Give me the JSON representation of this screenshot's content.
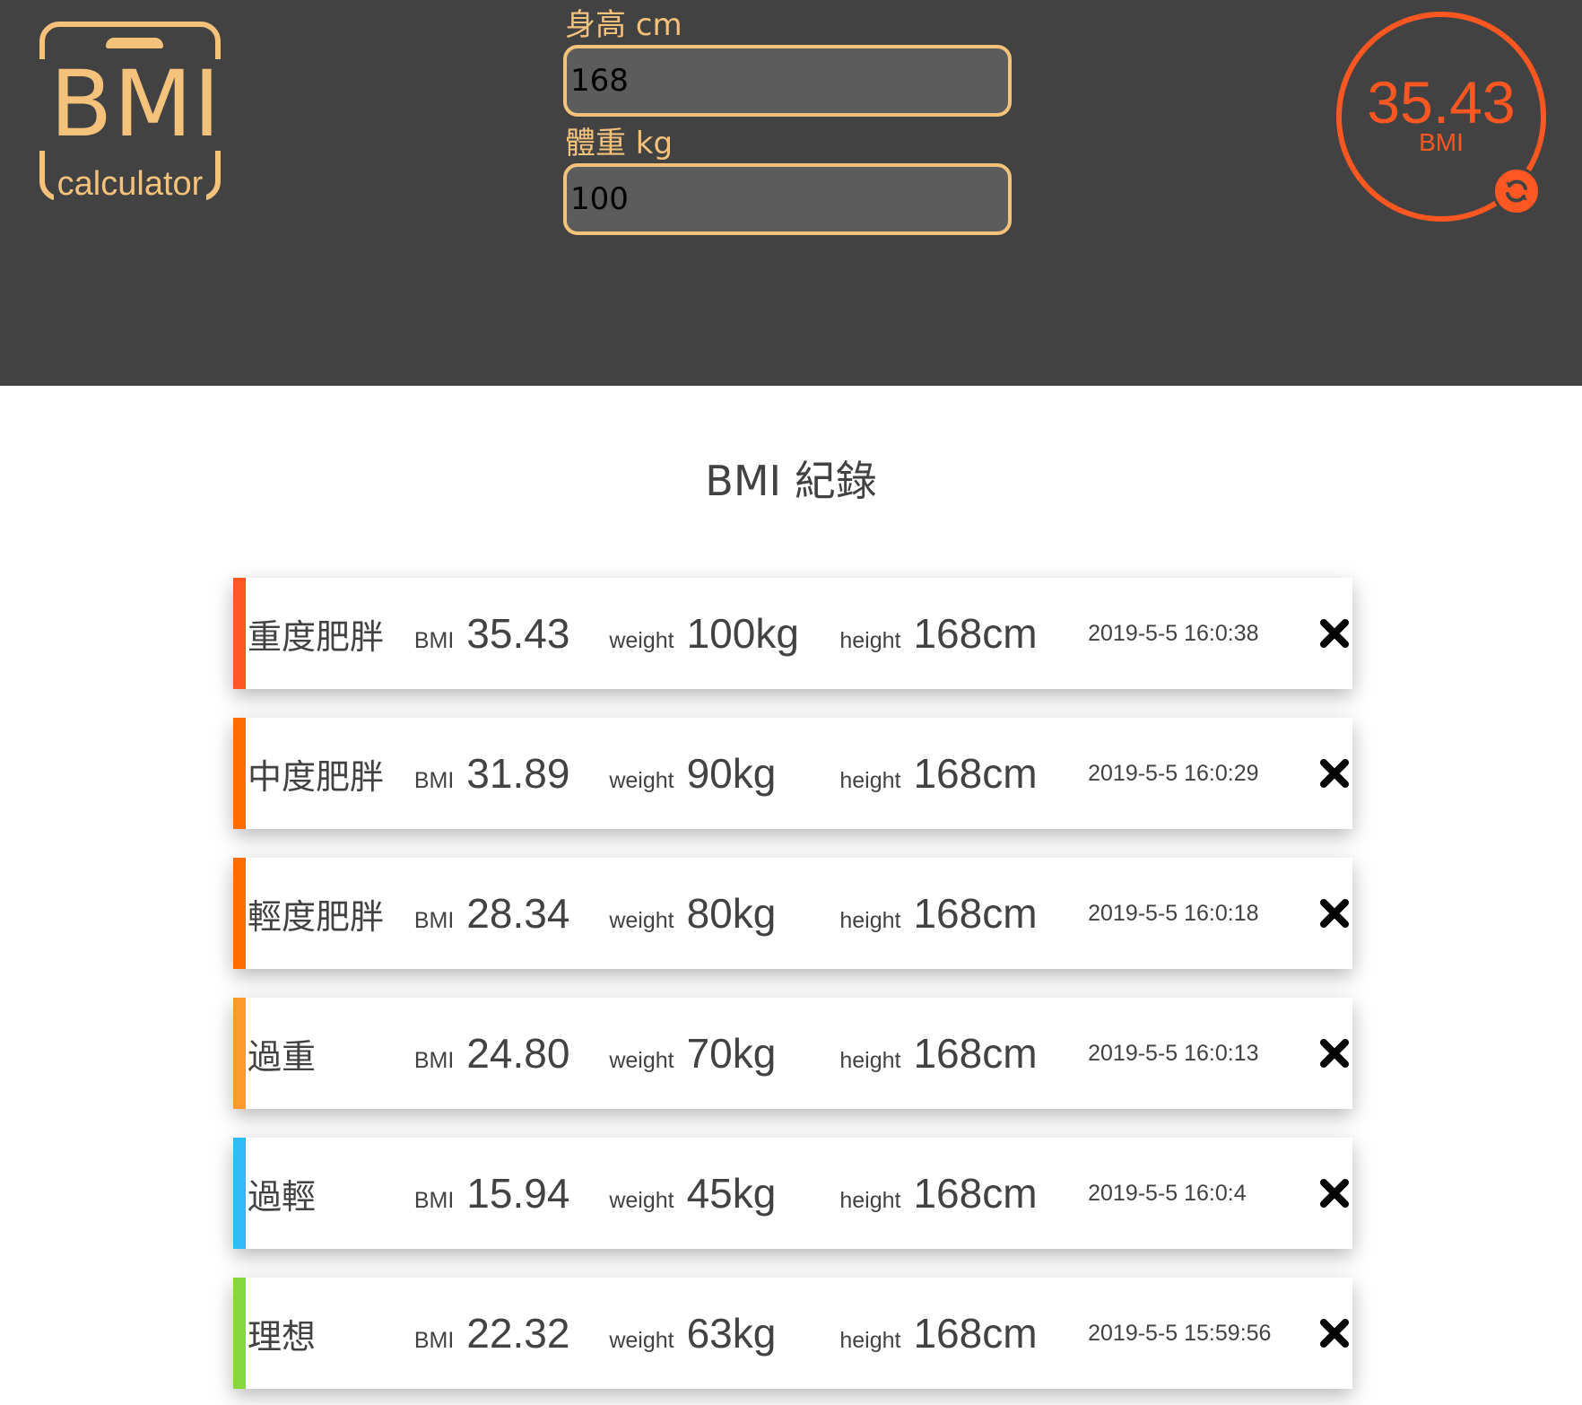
{
  "logo": {
    "text": "BMI",
    "subtitle": "calculator"
  },
  "form": {
    "height_label": "身高 cm",
    "height_value": "168",
    "weight_label": "體重 kg",
    "weight_value": "100"
  },
  "result": {
    "value": "35.43",
    "unit": "BMI",
    "reset_icon": "refresh-icon"
  },
  "records": {
    "title": "BMI 紀錄",
    "delete_icon": "close-icon",
    "items": [
      {
        "status": "重度肥胖",
        "bmi_label": "BMI",
        "bmi": "35.43",
        "weight_label": "weight",
        "weight": "100kg",
        "height_label": "height",
        "height": "168cm",
        "date": "2019-5-5 16:0:38",
        "color": "#ff5722"
      },
      {
        "status": "中度肥胖",
        "bmi_label": "BMI",
        "bmi": "31.89",
        "weight_label": "weight",
        "weight": "90kg",
        "height_label": "height",
        "height": "168cm",
        "date": "2019-5-5 16:0:29",
        "color": "#ff6c02"
      },
      {
        "status": "輕度肥胖",
        "bmi_label": "BMI",
        "bmi": "28.34",
        "weight_label": "weight",
        "weight": "80kg",
        "height_label": "height",
        "height": "168cm",
        "date": "2019-5-5 16:0:18",
        "color": "#ff6c02"
      },
      {
        "status": "過重",
        "bmi_label": "BMI",
        "bmi": "24.80",
        "weight_label": "weight",
        "weight": "70kg",
        "height_label": "height",
        "height": "168cm",
        "date": "2019-5-5 16:0:13",
        "color": "#ff982d"
      },
      {
        "status": "過輕",
        "bmi_label": "BMI",
        "bmi": "15.94",
        "weight_label": "weight",
        "weight": "45kg",
        "height_label": "height",
        "height": "168cm",
        "date": "2019-5-5 16:0:4",
        "color": "#31baf9"
      },
      {
        "status": "理想",
        "bmi_label": "BMI",
        "bmi": "22.32",
        "weight_label": "weight",
        "weight": "63kg",
        "height_label": "height",
        "height": "168cm",
        "date": "2019-5-5 15:59:56",
        "color": "#86d73f"
      }
    ]
  }
}
